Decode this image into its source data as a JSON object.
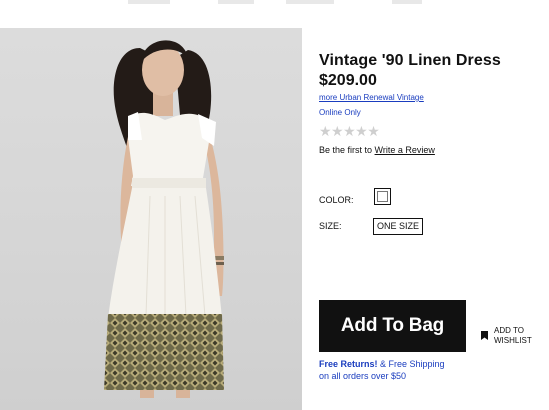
{
  "product": {
    "title": "Vintage '90 Linen Dress",
    "price": "$209.00",
    "collection_link": "more Urban Renewal Vintage",
    "availability": "Online Only",
    "rating": {
      "stars_filled": 0,
      "stars_total": 5,
      "star_glyph": "★★★★★"
    },
    "review": {
      "prefix": "Be the first to",
      "link": "Write a Review"
    }
  },
  "options": {
    "color_label": "COLOR:",
    "color_swatch": "#ffffff",
    "size_label": "SIZE:",
    "size_value": "ONE SIZE"
  },
  "actions": {
    "add_to_bag": "Add To Bag",
    "wishlist_line1": "ADD TO",
    "wishlist_line2": "WISHLIST"
  },
  "shipping": {
    "free_returns": "Free Returns!",
    "free_shipping": " & Free Shipping",
    "threshold": "on all orders over $50"
  },
  "colors": {
    "link_blue": "#1a3dbf",
    "button_black": "#111111",
    "photo_background": "#d6d6d6"
  }
}
